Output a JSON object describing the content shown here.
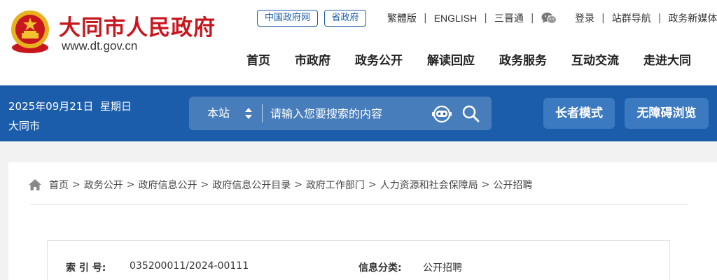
{
  "header": {
    "site_title": "大同市人民政府",
    "site_url": "www.dt.gov.cn",
    "pills": {
      "gov": "中国政府网",
      "province": "省政府"
    },
    "links_left": {
      "traditional": "繁體版",
      "english": "ENGLISH",
      "sanjin": "三晋通",
      "wechat_icon": "wechat-icon"
    },
    "links_right": {
      "login": "登录",
      "sitemap": "站群导航",
      "newmedia": "政务新媒体"
    },
    "nav": [
      "首页",
      "市政府",
      "政务公开",
      "解读回应",
      "政务服务",
      "互动交流",
      "走进大同"
    ]
  },
  "bar": {
    "date": "2025年09月21日  星期日",
    "city": "大同市",
    "search": {
      "scope": "本站",
      "placeholder": "请输入您要搜索的内容"
    },
    "elder_mode": "长者模式",
    "accessible": "无障碍浏览"
  },
  "breadcrumb": [
    "首页",
    "政务公开",
    "政府信息公开",
    "政府信息公开目录",
    "政府工作部门",
    "人力资源和社会保障局",
    "公开招聘"
  ],
  "info": {
    "index_label": "索 引 号:",
    "index_value": "035200011/2024-00111",
    "category_label": "信息分类:",
    "category_value": "公开招聘"
  },
  "colors": {
    "brand_red": "#c8161d",
    "bar_blue": "#1b5dab",
    "button_blue": "#3b79c1"
  }
}
